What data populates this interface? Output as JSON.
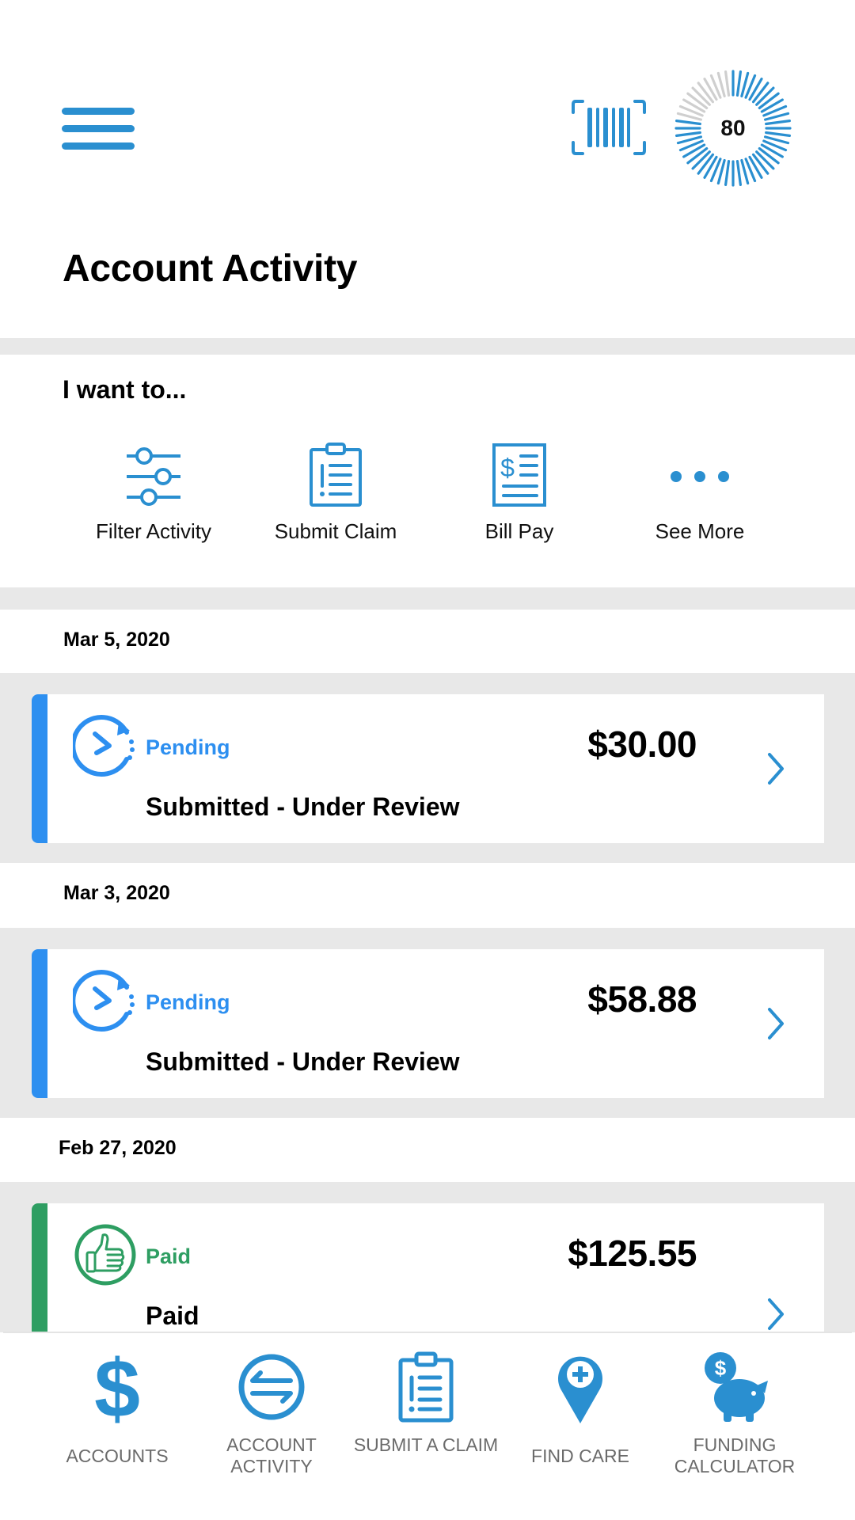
{
  "header": {
    "title": "Account Activity",
    "score": "80",
    "score_progress_fraction": 0.8,
    "menu_icon": "hamburger-menu-icon",
    "barcode_icon": "barcode-scan-icon"
  },
  "quick_actions": {
    "title": "I want to...",
    "items": [
      {
        "label": "Filter Activity",
        "icon": "sliders-filter-icon"
      },
      {
        "label": "Submit Claim",
        "icon": "clipboard-list-icon"
      },
      {
        "label": "Bill Pay",
        "icon": "bill-dollar-icon"
      },
      {
        "label": "See More",
        "icon": "more-dots-icon"
      }
    ]
  },
  "activity": [
    {
      "date": "Mar 5, 2020",
      "status": "Pending",
      "amount": "$30.00",
      "description": "Submitted - Under Review",
      "icon": "clock-pending-icon",
      "color": "#2d8ff0"
    },
    {
      "date": "Mar 3, 2020",
      "status": "Pending",
      "amount": "$58.88",
      "description": "Submitted - Under Review",
      "icon": "clock-pending-icon",
      "color": "#2d8ff0"
    },
    {
      "date": "Feb 27, 2020",
      "status": "Paid",
      "amount": "$125.55",
      "description": "Paid",
      "icon": "thumbs-up-icon",
      "color": "#2e9e62"
    }
  ],
  "bottom_nav": [
    {
      "label": "ACCOUNTS",
      "icon": "dollar-sign-icon"
    },
    {
      "label": "ACCOUNT ACTIVITY",
      "icon": "swap-arrows-icon"
    },
    {
      "label": "SUBMIT A CLAIM",
      "icon": "clipboard-list-icon"
    },
    {
      "label": "FIND CARE",
      "icon": "location-plus-icon"
    },
    {
      "label": "FUNDING CALCULATOR",
      "icon": "piggy-bank-icon"
    }
  ],
  "colors": {
    "brand_blue": "#2a8fd0",
    "pending_blue": "#2d8ff0",
    "paid_green": "#2e9e62",
    "band_gray": "#e8e8e8"
  }
}
